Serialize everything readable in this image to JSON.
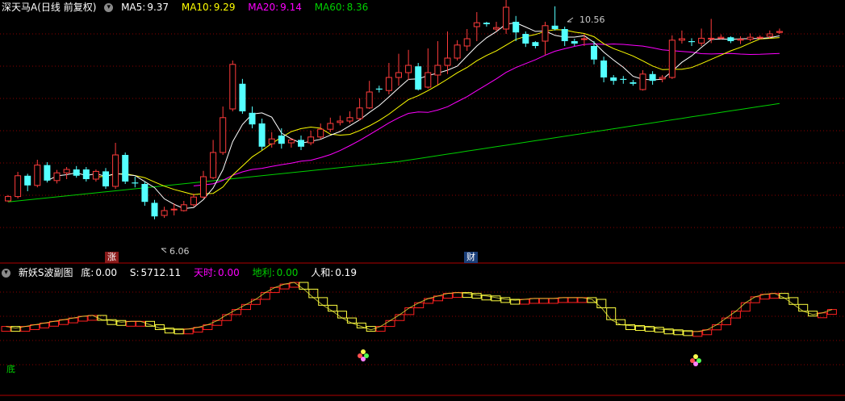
{
  "main_header": {
    "stock": "深天马A",
    "period": "(日线 前复权)",
    "ma5_label": "MA5:",
    "ma5": "9.37",
    "ma10_label": "MA10:",
    "ma10": "9.29",
    "ma20_label": "MA20:",
    "ma20": "9.14",
    "ma60_label": "MA60:",
    "ma60": "8.36"
  },
  "sub_header": {
    "name": "新妖S波副图",
    "di_label": "底:",
    "di": "0.00",
    "s_label": "S:",
    "s": "5712.11",
    "tianshi_label": "天时:",
    "tianshi": "0.00",
    "dili_label": "地利:",
    "dili": "0.00",
    "renhe_label": "人和:",
    "renhe": "0.19"
  },
  "markers": {
    "zhang": "涨",
    "cai": "财",
    "di": "底"
  },
  "colors": {
    "up": "#ff3b3b",
    "down": "#54ffff",
    "ma5": "#ffffff",
    "ma10": "#ffff00",
    "ma20": "#ff00ff",
    "ma60": "#00d000",
    "grid": "#8a0000"
  },
  "chart_data": {
    "type": "candlestick",
    "price_annotations": {
      "high": "10.56",
      "low": "6.06"
    },
    "candles": [
      [
        7.1,
        7.19,
        7.22,
        7.08
      ],
      [
        7.19,
        7.62,
        7.7,
        7.15
      ],
      [
        7.62,
        7.42,
        7.66,
        7.3
      ],
      [
        7.42,
        7.84,
        7.95,
        7.38
      ],
      [
        7.84,
        7.52,
        7.9,
        7.48
      ],
      [
        7.52,
        7.68,
        7.74,
        7.46
      ],
      [
        7.68,
        7.75,
        7.8,
        7.55
      ],
      [
        7.75,
        7.62,
        7.82,
        7.58
      ],
      [
        7.75,
        7.55,
        7.8,
        7.5
      ],
      [
        7.55,
        7.71,
        7.75,
        7.5
      ],
      [
        7.71,
        7.4,
        7.78,
        7.35
      ],
      [
        7.4,
        8.05,
        8.3,
        7.35
      ],
      [
        8.05,
        7.5,
        8.1,
        7.45
      ],
      [
        7.48,
        7.46,
        7.6,
        7.38
      ],
      [
        7.45,
        7.08,
        7.5,
        7.0
      ],
      [
        7.06,
        6.78,
        7.12,
        6.72
      ],
      [
        6.8,
        6.9,
        6.98,
        6.75
      ],
      [
        6.92,
        6.93,
        7.05,
        6.8
      ],
      [
        6.9,
        7.02,
        7.1,
        6.88
      ],
      [
        7.02,
        7.18,
        7.25,
        6.98
      ],
      [
        7.18,
        7.6,
        7.72,
        7.15
      ],
      [
        7.58,
        8.1,
        8.36,
        7.55
      ],
      [
        8.1,
        8.82,
        9.05,
        8.05
      ],
      [
        9.0,
        9.92,
        10.0,
        8.95
      ],
      [
        9.52,
        8.95,
        9.62,
        8.9
      ],
      [
        8.92,
        8.68,
        9.05,
        8.6
      ],
      [
        8.7,
        8.22,
        8.8,
        8.15
      ],
      [
        8.28,
        8.38,
        8.52,
        8.2
      ],
      [
        8.45,
        8.28,
        8.6,
        8.18
      ],
      [
        8.3,
        8.36,
        8.4,
        8.2
      ],
      [
        8.36,
        8.22,
        8.45,
        8.15
      ],
      [
        8.3,
        8.42,
        8.55,
        8.25
      ],
      [
        8.42,
        8.58,
        8.7,
        8.38
      ],
      [
        8.58,
        8.7,
        8.82,
        8.52
      ],
      [
        8.72,
        8.75,
        8.86,
        8.66
      ],
      [
        8.75,
        8.82,
        8.95,
        8.7
      ],
      [
        8.8,
        9.02,
        9.22,
        8.76
      ],
      [
        9.02,
        9.35,
        9.58,
        9.0
      ],
      [
        9.42,
        9.4,
        9.48,
        9.34
      ],
      [
        9.38,
        9.65,
        9.95,
        9.3
      ],
      [
        9.65,
        9.75,
        10.14,
        9.48
      ],
      [
        9.75,
        9.9,
        10.22,
        9.6
      ],
      [
        9.88,
        9.4,
        9.95,
        9.38
      ],
      [
        9.45,
        9.75,
        10.25,
        9.42
      ],
      [
        9.7,
        9.9,
        10.4,
        9.5
      ],
      [
        9.9,
        10.05,
        10.6,
        9.72
      ],
      [
        10.05,
        10.32,
        10.42,
        10.0
      ],
      [
        10.3,
        10.45,
        10.65,
        10.2
      ],
      [
        10.7,
        10.78,
        11.0,
        10.4
      ],
      [
        10.78,
        10.75,
        10.8,
        10.7
      ],
      [
        10.65,
        10.68,
        10.8,
        10.6
      ],
      [
        10.65,
        11.1,
        11.5,
        10.55
      ],
      [
        10.8,
        10.58,
        10.92,
        10.4
      ],
      [
        10.55,
        10.35,
        10.6,
        10.28
      ],
      [
        10.38,
        10.3,
        10.4,
        10.25
      ],
      [
        10.4,
        10.72,
        10.8,
        10.12
      ],
      [
        10.72,
        10.65,
        11.12,
        10.62
      ],
      [
        10.65,
        10.4,
        10.7,
        10.3
      ],
      [
        10.4,
        10.35,
        10.45,
        10.3
      ],
      [
        10.45,
        10.45,
        10.55,
        10.3
      ],
      [
        10.3,
        10.02,
        10.4,
        9.92
      ],
      [
        10.0,
        9.65,
        10.08,
        9.55
      ],
      [
        9.65,
        9.58,
        9.7,
        9.5
      ],
      [
        9.62,
        9.6,
        9.68,
        9.52
      ],
      [
        9.55,
        9.52,
        9.6,
        9.48
      ],
      [
        9.4,
        9.72,
        9.8,
        9.38
      ],
      [
        9.72,
        9.58,
        9.78,
        9.5
      ],
      [
        9.62,
        9.65,
        9.7,
        9.55
      ],
      [
        9.65,
        10.42,
        10.52,
        9.62
      ],
      [
        10.42,
        10.45,
        10.62,
        10.35
      ],
      [
        10.4,
        10.38,
        10.46,
        10.3
      ],
      [
        10.36,
        10.46,
        10.66,
        10.3
      ],
      [
        10.46,
        10.46,
        10.86,
        10.36
      ],
      [
        10.46,
        10.48,
        10.54,
        10.44
      ],
      [
        10.48,
        10.4,
        10.5,
        10.36
      ],
      [
        10.42,
        10.44,
        10.5,
        10.34
      ],
      [
        10.44,
        10.48,
        10.56,
        10.4
      ],
      [
        10.48,
        10.48,
        10.52,
        10.44
      ],
      [
        10.5,
        10.55,
        10.62,
        10.46
      ],
      [
        10.58,
        10.6,
        10.66,
        10.55
      ]
    ],
    "sub_values": [
      0.48,
      0.46,
      0.48,
      0.5,
      0.52,
      0.54,
      0.56,
      0.58,
      0.6,
      0.61,
      0.56,
      0.55,
      0.53,
      0.54,
      0.54,
      0.5,
      0.46,
      0.45,
      0.44,
      0.45,
      0.47,
      0.5,
      0.55,
      0.62,
      0.68,
      0.74,
      0.8,
      0.88,
      0.94,
      0.98,
      1.0,
      0.92,
      0.82,
      0.73,
      0.66,
      0.58,
      0.52,
      0.48,
      0.44,
      0.48,
      0.55,
      0.62,
      0.7,
      0.76,
      0.81,
      0.84,
      0.87,
      0.88,
      0.87,
      0.85,
      0.84,
      0.82,
      0.8,
      0.79,
      0.8,
      0.81,
      0.81,
      0.81,
      0.82,
      0.82,
      0.82,
      0.8,
      0.7,
      0.56,
      0.5,
      0.49,
      0.48,
      0.47,
      0.45,
      0.44,
      0.43,
      0.42,
      0.42,
      0.44,
      0.5,
      0.58,
      0.66,
      0.76,
      0.83,
      0.86,
      0.87,
      0.82,
      0.74,
      0.66,
      0.62,
      0.64,
      0.68
    ]
  }
}
